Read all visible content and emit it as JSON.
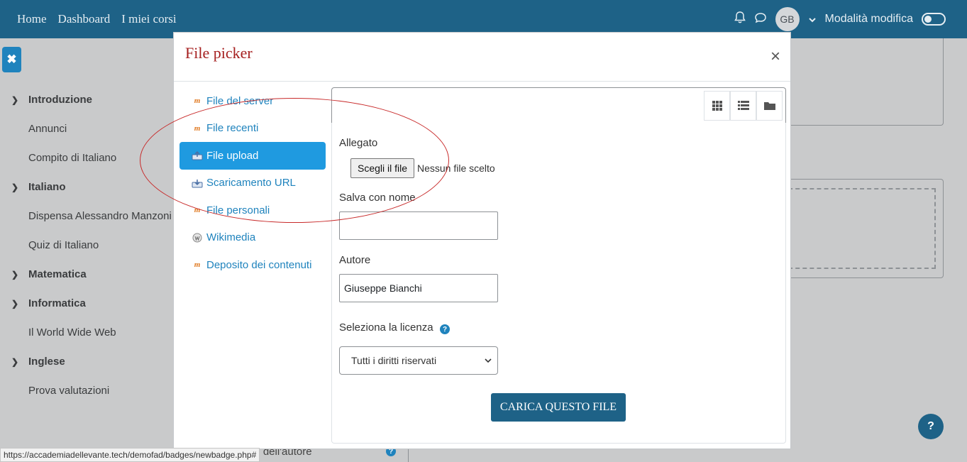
{
  "navbar": {
    "links": [
      "Home",
      "Dashboard",
      "I miei corsi"
    ],
    "avatar_initials": "GB",
    "edit_mode_label": "Modalità modifica",
    "icons": [
      "bell-icon",
      "chat-icon",
      "chevron-down-icon"
    ]
  },
  "course_index": {
    "items": [
      {
        "type": "section",
        "label": "Introduzione"
      },
      {
        "type": "activity",
        "label": "Annunci"
      },
      {
        "type": "activity",
        "label": "Compito di Italiano"
      },
      {
        "type": "section",
        "label": "Italiano"
      },
      {
        "type": "activity",
        "label": "Dispensa Alessandro Manzoni"
      },
      {
        "type": "activity",
        "label": "Quiz di Italiano"
      },
      {
        "type": "section",
        "label": "Matematica"
      },
      {
        "type": "section",
        "label": "Informatica"
      },
      {
        "type": "activity",
        "label": "Il World Wide Web"
      },
      {
        "type": "section",
        "label": "Inglese"
      },
      {
        "type": "activity",
        "label": "Prova valutazioni"
      }
    ]
  },
  "background": {
    "bottom_text": "il dell'autore"
  },
  "status_bar": {
    "url": "https://accademiadellevante.tech/demofad/badges/newbadge.php#"
  },
  "file_picker": {
    "title": "File picker",
    "close_glyph": "×",
    "repositories": [
      {
        "label": "File del server",
        "icon": "moodle-icon",
        "active": false
      },
      {
        "label": "File recenti",
        "icon": "moodle-icon",
        "active": false
      },
      {
        "label": "File upload",
        "icon": "upload-icon",
        "active": true
      },
      {
        "label": "Scaricamento URL",
        "icon": "url-download-icon",
        "active": false
      },
      {
        "label": "File personali",
        "icon": "moodle-icon",
        "active": false
      },
      {
        "label": "Wikimedia",
        "icon": "wikimedia-icon",
        "active": false
      },
      {
        "label": "Deposito dei contenuti",
        "icon": "moodle-icon",
        "active": false
      }
    ],
    "view_buttons": [
      "grid-view-icon",
      "list-view-icon",
      "folder-view-icon"
    ],
    "form": {
      "attachment_label": "Allegato",
      "choose_file_label": "Scegli il file",
      "no_file_text": "Nessun file scelto",
      "save_as_label": "Salva con nome",
      "save_as_value": "",
      "author_label": "Autore",
      "author_value": "Giuseppe Bianchi",
      "license_label": "Seleziona la licenza",
      "license_value": "Tutti i diritti riservati",
      "upload_button": "CARICA QUESTO FILE"
    }
  },
  "colors": {
    "navbar": "#1e6287",
    "primary": "#1f83bd",
    "active_repo": "#1f9ae0",
    "title": "#a51f1f",
    "annotation": "#c82a2a"
  }
}
